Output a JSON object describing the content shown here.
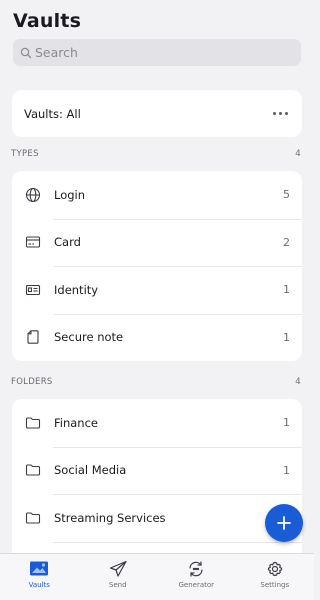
{
  "header": {
    "title": "Vaults"
  },
  "search": {
    "placeholder": "Search"
  },
  "vault_filter": {
    "label": "Vaults: All",
    "menu_icon": "more-horizontal-icon"
  },
  "types": {
    "heading": "TYPES",
    "count": "4",
    "items": [
      {
        "label": "Login",
        "count": "5",
        "icon": "globe-icon"
      },
      {
        "label": "Card",
        "count": "2",
        "icon": "credit-card-icon"
      },
      {
        "label": "Identity",
        "count": "1",
        "icon": "id-card-icon"
      },
      {
        "label": "Secure note",
        "count": "1",
        "icon": "note-icon"
      }
    ]
  },
  "folders": {
    "heading": "FOLDERS",
    "count": "4",
    "items": [
      {
        "label": "Finance",
        "count": "1",
        "icon": "folder-icon"
      },
      {
        "label": "Social Media",
        "count": "1",
        "icon": "folder-icon"
      },
      {
        "label": "Streaming Services",
        "count": "",
        "icon": "folder-icon"
      }
    ]
  },
  "fab": {
    "icon": "plus-icon"
  },
  "tabbar": {
    "tabs": [
      {
        "label": "Vaults",
        "icon": "vault-icon",
        "active": true
      },
      {
        "label": "Send",
        "icon": "send-icon",
        "active": false
      },
      {
        "label": "Generator",
        "icon": "generator-icon",
        "active": false
      },
      {
        "label": "Settings",
        "icon": "gear-icon",
        "active": false
      }
    ]
  },
  "colors": {
    "accent": "#1a5cd6",
    "background": "#f2f2f5",
    "card": "#ffffff"
  }
}
